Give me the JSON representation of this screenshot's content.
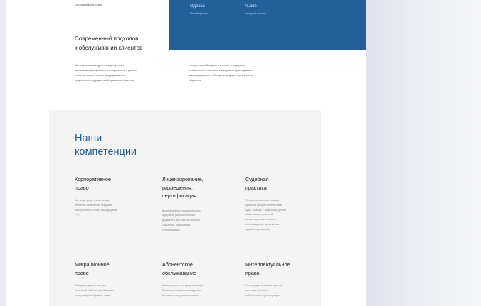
{
  "top_fragment": "рос фармаком,недок",
  "offices": [
    {
      "name": "Одесса",
      "sub": "Южный филиал"
    },
    {
      "name": "Львов",
      "sub": "Западный филиал"
    }
  ],
  "section_title": [
    "Современный подходов",
    "к обслуживании клиентов"
  ],
  "paragraphs": [
    [
      "Мы собрали команду из мегадиз, умных к",
      "высококвалифицированных специалистов в разных",
      "отраслях права, которые придерживается",
      "современных подходов в обслуживании клиентов"
    ],
    [
      "Неизуклено соблюдаем этические стандарты в",
      "отношениях с клиентами и завершено прикладываем",
      "максимум усилий чтобы достичь лучшего для клиента",
      "результата"
    ]
  ],
  "competencies": {
    "title": [
      "Наши",
      "компетенции"
    ],
    "cards": [
      {
        "title": [
          "Корпоративное",
          "право"
        ],
        "text": [
          "Все виды услуг (регистрация,",
          "внесение изменений, передача",
          "корпоративных прав, ликвидация и",
          "т.п.)"
        ]
      },
      {
        "title": [
          "Лицензирование,",
          "разрешения,",
          "сертификация"
        ],
        "text": [
          "В минимальные сроки поможем",
          "оформить разрешительные",
          "документы для работы бизнеса",
          "(лицензии, разрешения,",
          "сертификация)"
        ]
      },
      {
        "title": [
          "Судебная",
          "практика"
        ],
        "text": [
          "Профессиональная помощь",
          "адвоката (защита интересов в",
          "суде, помощь с вопросами долгов,",
          "обжалование решений",
          "контролирующих органов,",
          "сопровождение выполнения",
          "судебного решения)"
        ]
      },
      {
        "title": [
          "Миграционное",
          "право"
        ],
        "text": [
          "Оформим документы, для",
          "легальной работы и пребывания",
          "иностранцев в Украине, также"
        ]
      },
      {
        "title": [
          "Абонентское",
          "обслуживание"
        ],
        "text": [
          "Оказание услуг по юридическому и",
          "бухгалтерскому сопровождению",
          "бизнеса на регулярной основе"
        ]
      },
      {
        "title": [
          "Интеллектуальное",
          "право"
        ],
        "text": [
          "Регистрация и защита прав на",
          "интеллектуальную",
          "собственность (регистрация"
        ]
      }
    ]
  }
}
